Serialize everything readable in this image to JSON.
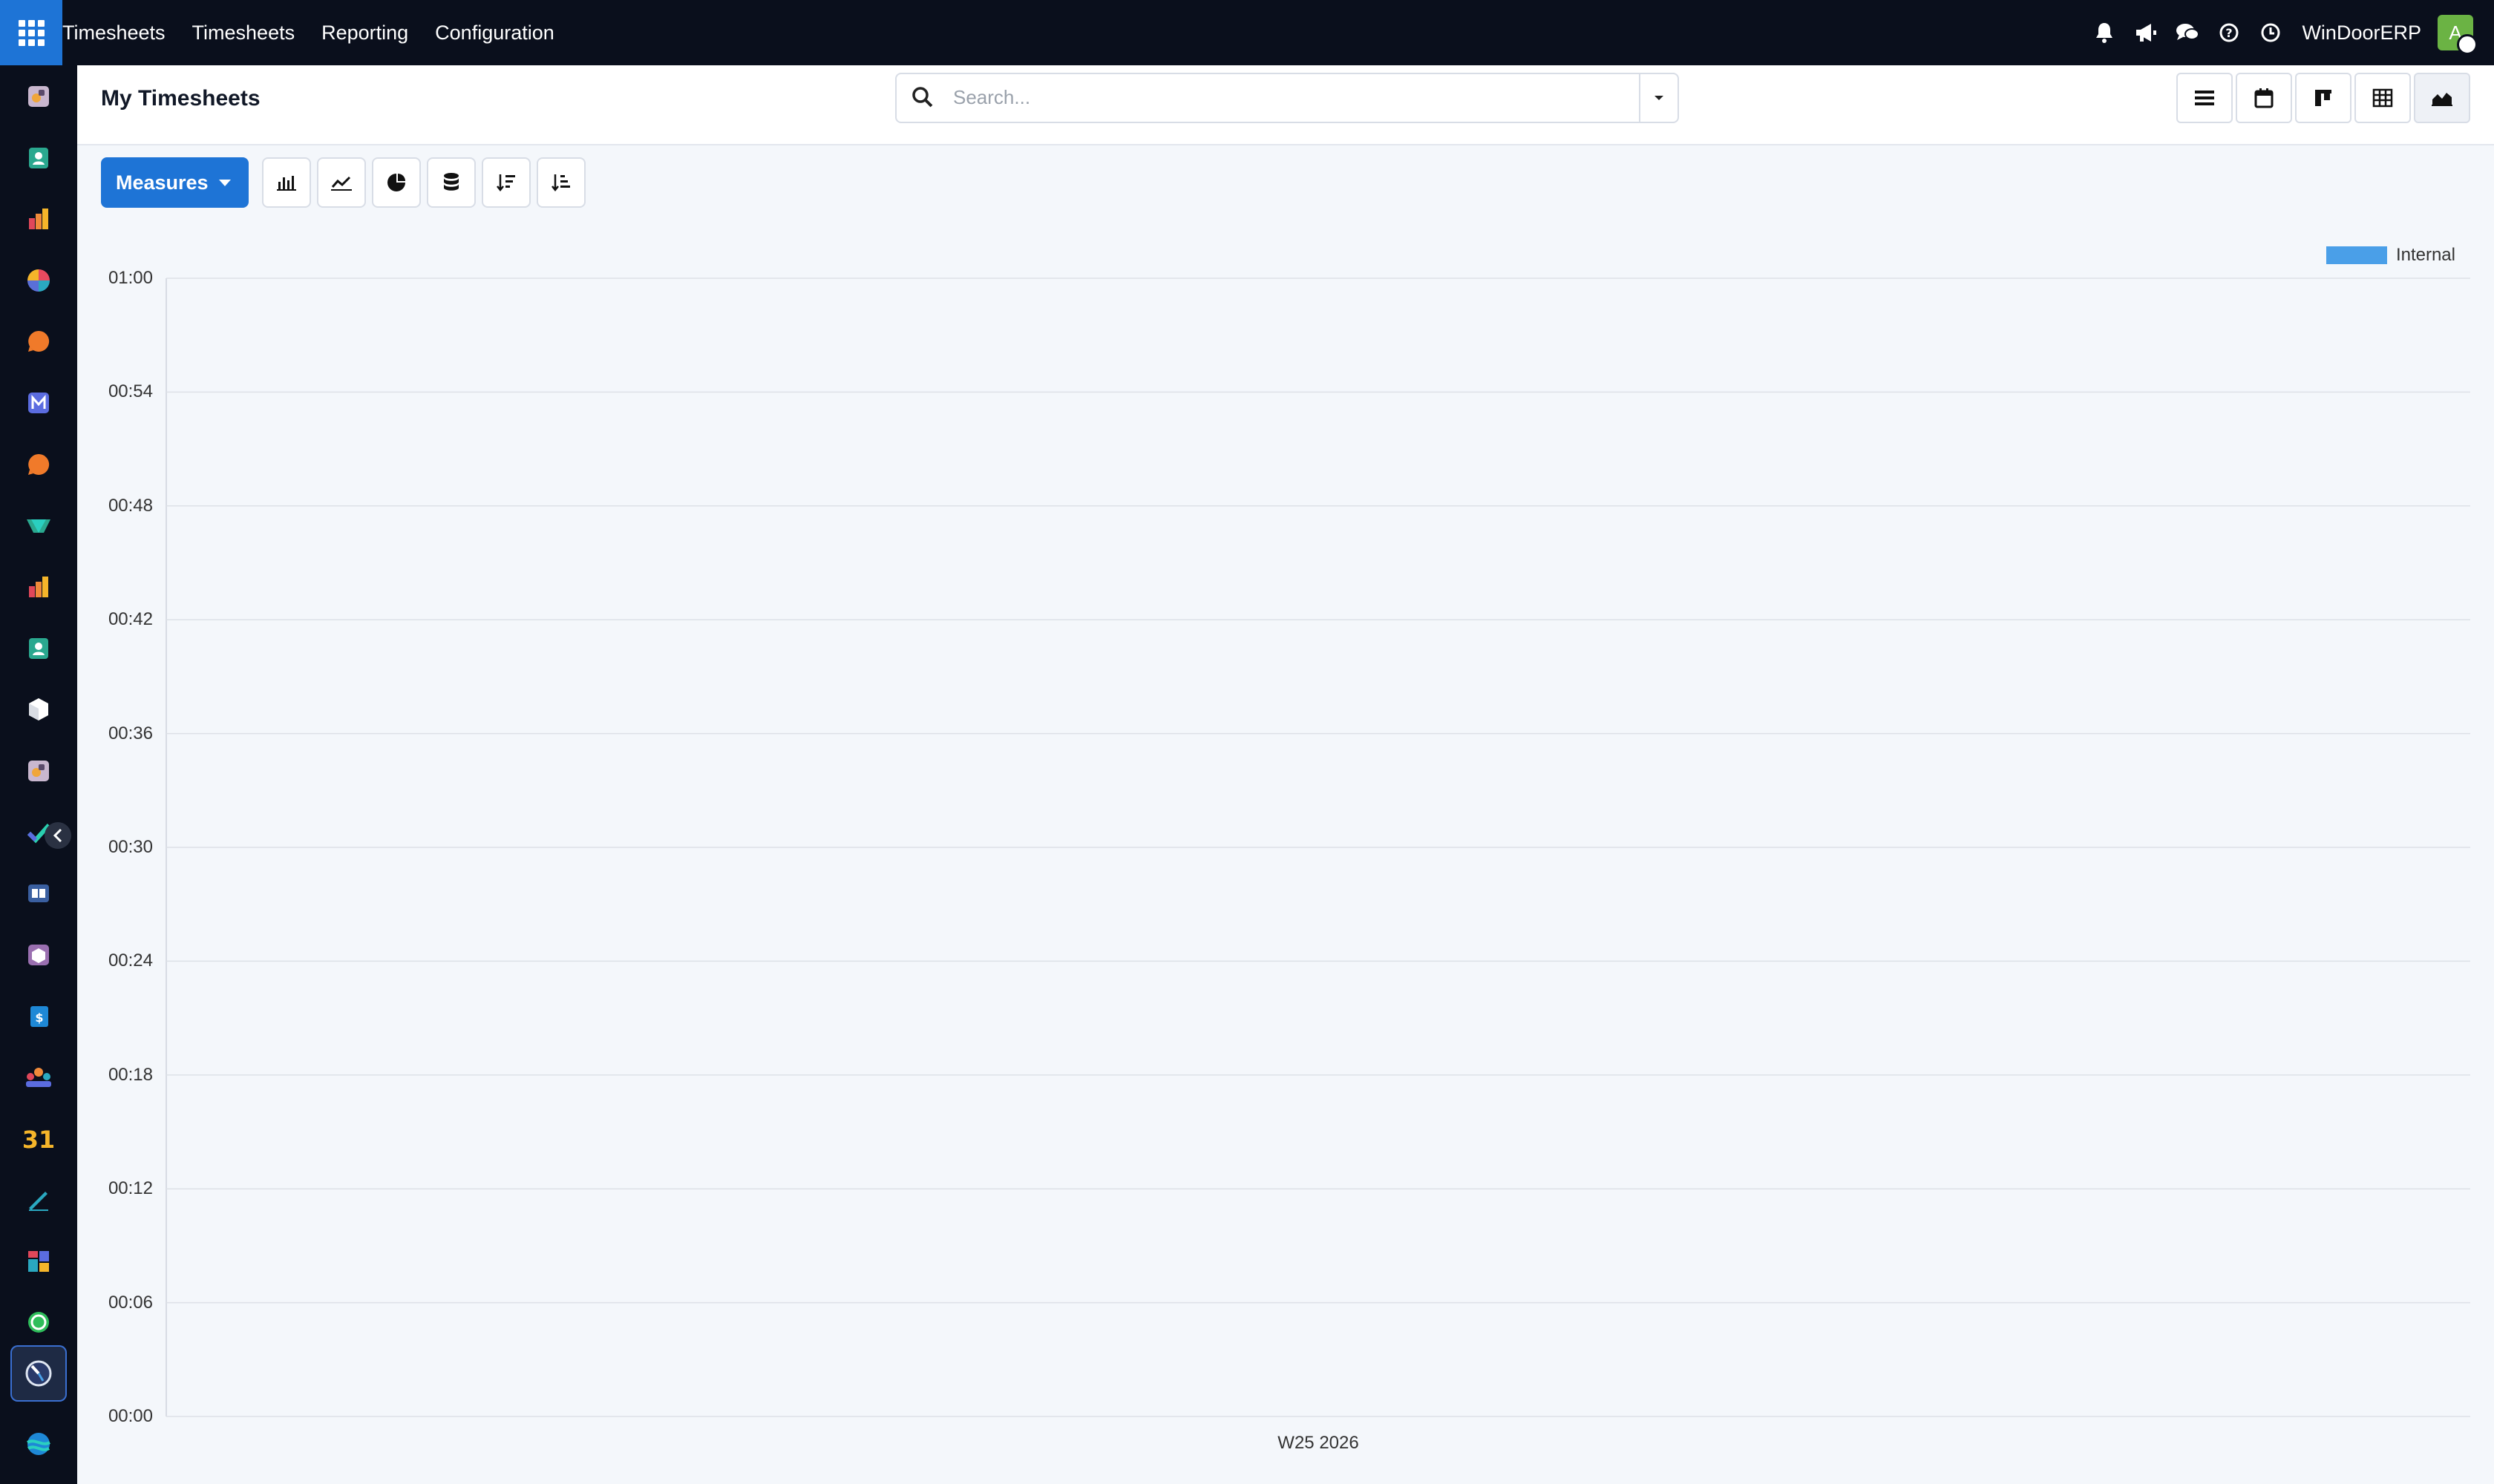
{
  "topbar": {
    "menus": [
      "Timesheets",
      "Timesheets",
      "Reporting",
      "Configuration"
    ],
    "company": "WinDoorERP",
    "avatar_letter": "A"
  },
  "control_panel": {
    "title": "My Timesheets",
    "search_placeholder": "Search..."
  },
  "toolbar": {
    "measures_label": "Measures"
  },
  "colors": {
    "accent": "#1e74d6",
    "series_internal": "#4a9fe8",
    "topbar": "#0a0f1c"
  },
  "sidebar": {
    "icons": [
      "photo-app-icon",
      "contacts-icon",
      "reporting-icon",
      "dashboard-pie-icon",
      "discuss-icon",
      "email-marketing-icon",
      "chat-icon",
      "project-icon",
      "sales-icon",
      "contacts-icon-2",
      "inventory-icon",
      "photo-app-icon-2",
      "todo-icon",
      "knowledge-icon",
      "purchase-icon",
      "invoicing-icon",
      "employees-icon",
      "calendar-icon",
      "sign-icon",
      "dashboards-icon",
      "whatsapp-icon",
      "timesheets-icon",
      "website-icon"
    ],
    "active": "timesheets-icon"
  },
  "chart_data": {
    "type": "area",
    "x": [
      "W25 2026"
    ],
    "series": [
      {
        "name": "Internal",
        "values": [
          0
        ]
      }
    ],
    "ylim": [
      "00:00",
      "01:00"
    ],
    "yticks": [
      "00:00",
      "00:06",
      "00:12",
      "00:18",
      "00:24",
      "00:30",
      "00:36",
      "00:42",
      "00:48",
      "00:54",
      "01:00"
    ],
    "grid": true,
    "legend": "top-right"
  }
}
